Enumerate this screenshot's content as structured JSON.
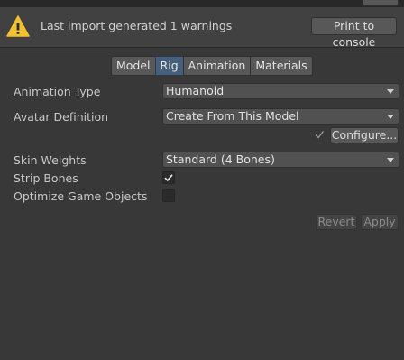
{
  "warning": {
    "icon": "warning-icon",
    "message": "Last import generated 1 warnings",
    "print_button": "Print to console"
  },
  "tabs": [
    {
      "label": "Model",
      "active": false
    },
    {
      "label": "Rig",
      "active": true
    },
    {
      "label": "Animation",
      "active": false
    },
    {
      "label": "Materials",
      "active": false
    }
  ],
  "fields": {
    "animation_type": {
      "label": "Animation Type",
      "value": "Humanoid"
    },
    "avatar_definition": {
      "label": "Avatar Definition",
      "value": "Create From This Model"
    },
    "configure_button": "Configure...",
    "skin_weights": {
      "label": "Skin Weights",
      "value": "Standard (4 Bones)"
    },
    "strip_bones": {
      "label": "Strip Bones",
      "checked": true
    },
    "optimize_game_objects": {
      "label": "Optimize Game Objects",
      "checked": false
    }
  },
  "actions": {
    "revert": "Revert",
    "apply": "Apply"
  },
  "colors": {
    "background": "#383838",
    "active_tab": "#46607c",
    "warning_yellow": "#f2c12e"
  }
}
